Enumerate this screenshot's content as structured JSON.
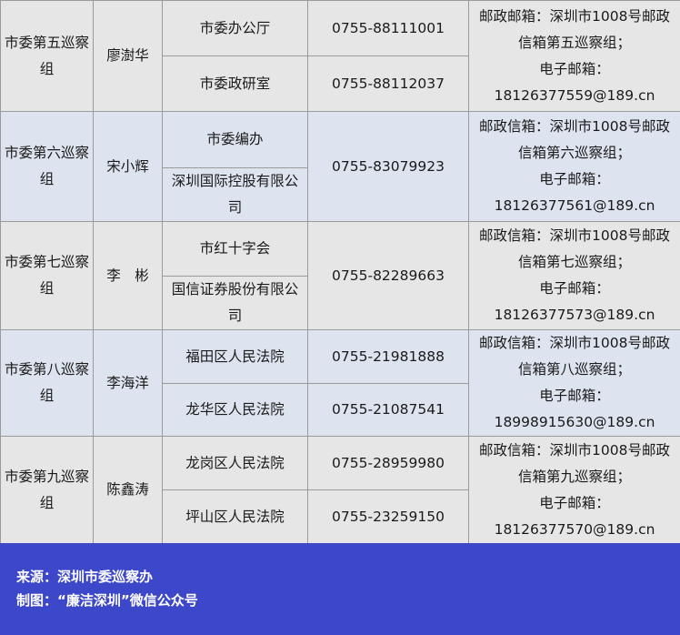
{
  "groups": [
    {
      "name": "市委第五巡察组",
      "leader": "廖澍华",
      "units": [
        "市委办公厅",
        "市委政研室"
      ],
      "phones": [
        "0755-88111001",
        "0755-88112037"
      ],
      "contact": [
        "邮政邮箱：深圳市1008号邮政",
        "信箱第五巡察组；",
        "电子邮箱：",
        "18126377559@189.cn"
      ]
    },
    {
      "name": "市委第六巡察组",
      "leader": "宋小辉",
      "units": [
        "市委编办",
        "深圳国际控股有限公司"
      ],
      "phones": [
        "0755-83079923"
      ],
      "contact": [
        "邮政信箱：深圳市1008号邮政",
        "信箱第六巡察组；",
        "电子邮箱：",
        "18126377561@189.cn"
      ]
    },
    {
      "name": "市委第七巡察组",
      "leader": "李　彬",
      "units": [
        "市红十字会",
        "国信证券股份有限公司"
      ],
      "phones": [
        "0755-82289663"
      ],
      "contact": [
        "邮政信箱：深圳市1008号邮政",
        "信箱第七巡察组；",
        "电子邮箱：",
        "18126377573@189.cn"
      ]
    },
    {
      "name": "市委第八巡察组",
      "leader": "李海洋",
      "units": [
        "福田区人民法院",
        "龙华区人民法院"
      ],
      "phones": [
        "0755-21981888",
        "0755-21087541"
      ],
      "contact": [
        "邮政信箱：深圳市1008号邮政",
        "信箱第八巡察组；",
        "电子邮箱：",
        "18998915630@189.cn"
      ]
    },
    {
      "name": "市委第九巡察组",
      "leader": "陈鑫涛",
      "units": [
        "龙岗区人民法院",
        "坪山区人民法院"
      ],
      "phones": [
        "0755-28959980",
        "0755-23259150"
      ],
      "contact": [
        "邮政信箱：深圳市1008号邮政",
        "信箱第九巡察组；",
        "电子邮箱：",
        "18126377570@189.cn"
      ]
    }
  ],
  "footer": {
    "source": "来源：深圳市委巡察办",
    "made_by": "制图：“廉洁深圳”微信公众号"
  }
}
